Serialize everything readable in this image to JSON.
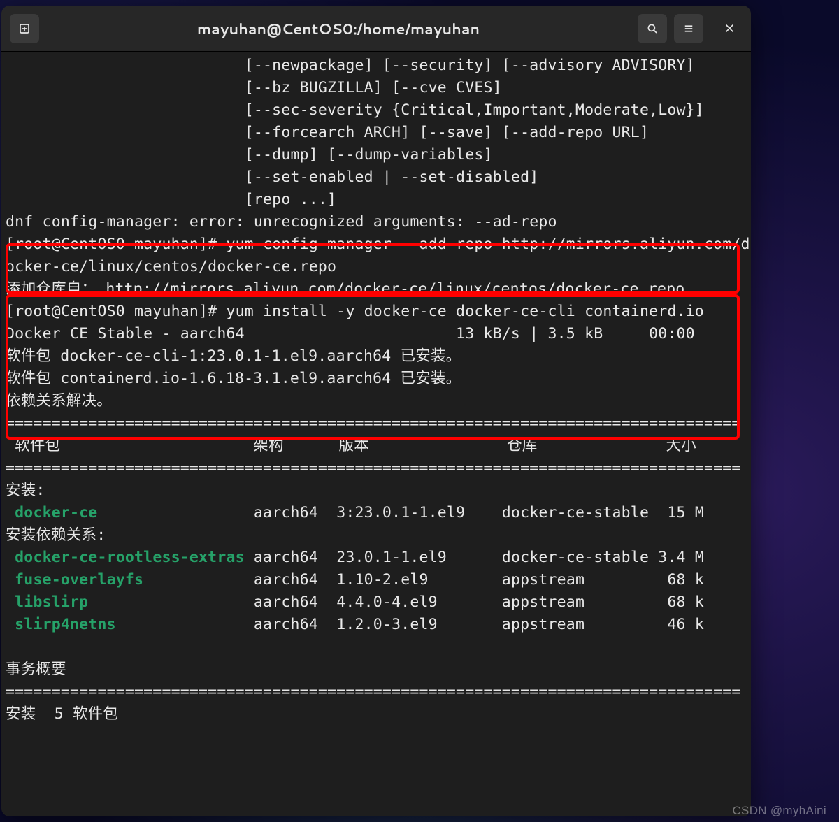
{
  "window": {
    "title": "mayuhan@CentOS0:/home/mayuhan"
  },
  "help_lines": [
    "                          [--newpackage] [--security] [--advisory ADVISORY]",
    "                          [--bz BUGZILLA] [--cve CVES]",
    "                          [--sec-severity {Critical,Important,Moderate,Low}]",
    "                          [--forcearch ARCH] [--save] [--add-repo URL]",
    "                          [--dump] [--dump-variables]",
    "                          [--set-enabled | --set-disabled]",
    "                          [repo ...]"
  ],
  "error_line": "dnf config-manager: error: unrecognized arguments: --ad-repo",
  "cmd1": {
    "prompt": "[root@CentOS0 mayuhan]# ",
    "text": "yum-config-manager --add-repo http://mirrors.aliyun.com/docker-ce/linux/centos/docker-ce.repo"
  },
  "add_repo_line": "添加仓库自： http://mirrors.aliyun.com/docker-ce/linux/centos/docker-ce.repo",
  "cmd2": {
    "prompt": "[root@CentOS0 mayuhan]# ",
    "text": "yum install -y docker-ce docker-ce-cli containerd.io"
  },
  "download_line": "Docker CE Stable - aarch64                       13 kB/s | 3.5 kB     00:00",
  "installed_lines": [
    "软件包 docker-ce-cli-1:23.0.1-1.el9.aarch64 已安装。",
    "软件包 containerd.io-1.6.18-3.1.el9.aarch64 已安装。"
  ],
  "dep_solved": "依赖关系解决。",
  "sep": "================================================================================",
  "table_header": " 软件包                     架构      版本               仓库              大小",
  "section_install": "安装:",
  "section_deps": "安装依赖关系:",
  "packages": [
    {
      "name": "docker-ce",
      "pad": "                 ",
      "arch": "aarch64",
      "ver": "3:23.0.1-1.el9",
      "vpad": "    ",
      "repo": "docker-ce-stable",
      "rpad": "  ",
      "size": "15 M"
    },
    {
      "name": "docker-ce-rootless-extras",
      "pad": " ",
      "arch": "aarch64",
      "ver": "23.0.1-1.el9",
      "vpad": "      ",
      "repo": "docker-ce-stable",
      "rpad": " ",
      "size": "3.4 M"
    },
    {
      "name": "fuse-overlayfs",
      "pad": "            ",
      "arch": "aarch64",
      "ver": "1.10-2.el9",
      "vpad": "        ",
      "repo": "appstream",
      "rpad": "         ",
      "size": "68 k"
    },
    {
      "name": "libslirp",
      "pad": "                  ",
      "arch": "aarch64",
      "ver": "4.4.0-4.el9",
      "vpad": "       ",
      "repo": "appstream",
      "rpad": "         ",
      "size": "68 k"
    },
    {
      "name": "slirp4netns",
      "pad": "               ",
      "arch": "aarch64",
      "ver": "1.2.0-3.el9",
      "vpad": "       ",
      "repo": "appstream",
      "rpad": "         ",
      "size": "46 k"
    }
  ],
  "summary_title": "事务概要",
  "summary_line": "安装  5 软件包",
  "watermark": "CSDN @myhAini"
}
